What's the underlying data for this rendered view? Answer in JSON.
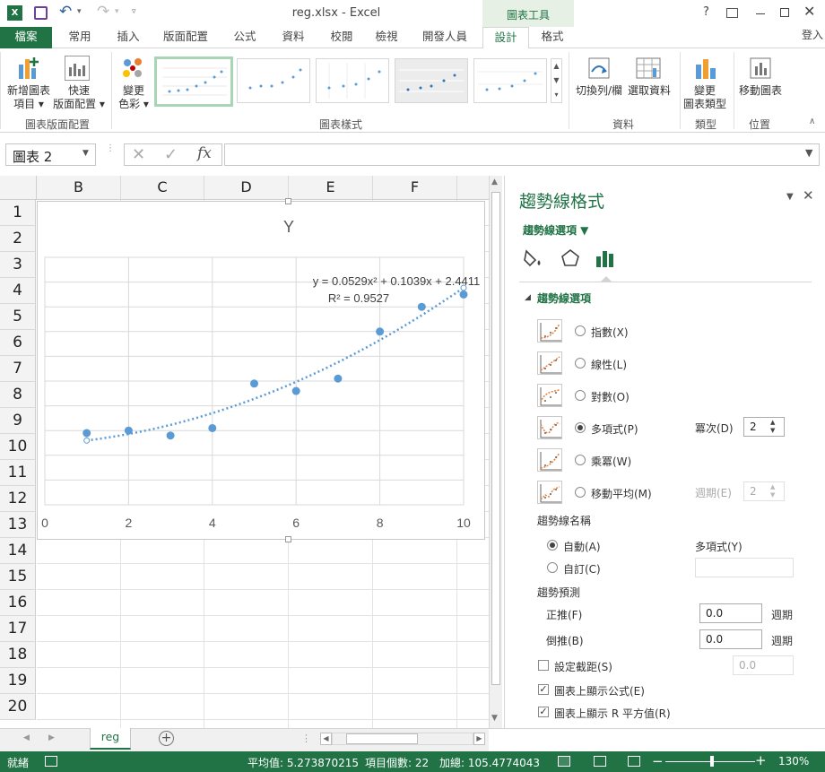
{
  "app": {
    "title": "reg.xlsx - Excel",
    "context_tab_group": "圖表工具",
    "signin": "登入",
    "help": "?"
  },
  "tabs": [
    "檔案",
    "常用",
    "插入",
    "版面配置",
    "公式",
    "資料",
    "校閱",
    "檢視",
    "開發人員",
    "設計",
    "格式"
  ],
  "ribbon": {
    "add_element": "新增圖表\n項目 ▾",
    "quick_layout": "快速\n版面配置 ▾",
    "change_colors": "變更\n色彩 ▾",
    "switch_row_col": "切換列/欄",
    "select_data": "選取資料",
    "change_type": "變更\n圖表類型",
    "move_chart": "移動圖表",
    "group_layouts": "圖表版面配置",
    "group_styles": "圖表樣式",
    "group_data": "資料",
    "group_type": "類型",
    "group_location": "位置"
  },
  "formula": {
    "namebox": "圖表 2",
    "fx": "fx",
    "value": ""
  },
  "columns": [
    "B",
    "C",
    "D",
    "E",
    "F"
  ],
  "rows": [
    "1",
    "2",
    "3",
    "4",
    "5",
    "6",
    "7",
    "8",
    "9",
    "10",
    "11",
    "12",
    "13",
    "14",
    "15",
    "16",
    "17",
    "18",
    "19",
    "20"
  ],
  "chart_data": {
    "type": "scatter",
    "title": "Y",
    "x": [
      1,
      2,
      3,
      4,
      5,
      6,
      7,
      8,
      9,
      10
    ],
    "y": [
      2.9,
      3.0,
      2.8,
      3.1,
      4.9,
      4.6,
      5.1,
      7.0,
      8.0,
      8.5
    ],
    "xlim": [
      0,
      10
    ],
    "x_ticks": [
      "0",
      "2",
      "4",
      "6",
      "8",
      "10"
    ],
    "trendline": {
      "type": "polynomial",
      "order": 2,
      "coefficients": [
        0.0529,
        0.1039,
        2.4411
      ],
      "style": "dotted"
    },
    "equation": "y = 0.0529x² + 0.1039x + 2.4411",
    "r_squared": "R² = 0.9527",
    "grid": true,
    "color": "#5b9bd5"
  },
  "panel": {
    "title": "趨勢線格式",
    "subtitle": "趨勢線選項 ▼",
    "section": "趨勢線選項",
    "options": [
      {
        "label": "指數(X)",
        "selected": false
      },
      {
        "label": "線性(L)",
        "selected": false
      },
      {
        "label": "對數(O)",
        "selected": false
      },
      {
        "label": "多項式(P)",
        "selected": true
      },
      {
        "label": "乘冪(W)",
        "selected": false
      },
      {
        "label": "移動平均(M)",
        "selected": false
      }
    ],
    "order_label": "冪次(D)",
    "order_value": "2",
    "period_label": "週期(E)",
    "period_value": "2",
    "name_header": "趨勢線名稱",
    "name_auto": "自動(A)",
    "name_auto_value": "多項式(Y)",
    "name_custom": "自訂(C)",
    "forecast_header": "趨勢預測",
    "forward": "正推(F)",
    "forward_value": "0.0",
    "backward": "倒推(B)",
    "backward_value": "0.0",
    "periods_unit": "週期",
    "intercept": "設定截距(S)",
    "intercept_value": "0.0",
    "show_equation": "圖表上顯示公式(E)",
    "show_r2": "圖表上顯示 R 平方值(R)"
  },
  "sheet": {
    "tab": "reg"
  },
  "status": {
    "ready": "就緒",
    "average": "平均值: 5.273870215",
    "count": "項目個數: 22",
    "sum": "加總: 105.4774043",
    "zoom": "130%"
  }
}
